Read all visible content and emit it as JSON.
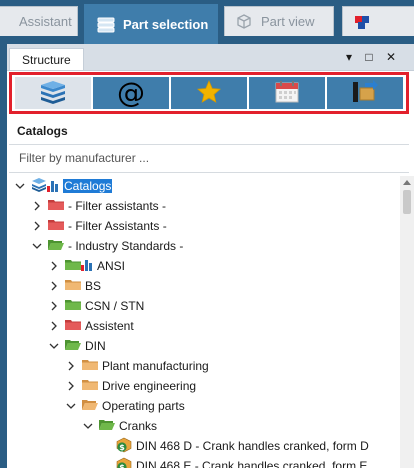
{
  "tabs": [
    {
      "label": "Assistant",
      "active": false
    },
    {
      "label": "Part selection",
      "active": true
    },
    {
      "label": "Part view",
      "active": false
    }
  ],
  "panel": {
    "tab_label": "Structure",
    "window_buttons": [
      "▾",
      "□",
      "✕"
    ],
    "toolbar_icons": [
      "catalog-stack-icon",
      "at-sign-icon",
      "star-icon",
      "calendar-icon",
      "export-icon"
    ],
    "toolbar_at_glyph": "@",
    "section_title": "Catalogs",
    "filter_placeholder": "Filter by manufacturer ..."
  },
  "tree": [
    {
      "label": "Catalogs",
      "level": 0,
      "expanded": true,
      "icon": "catalog-root-icon",
      "selected": true
    },
    {
      "label": "- Filter assistants -",
      "level": 1,
      "expanded": false,
      "icon": "red-folder-icon"
    },
    {
      "label": "- Filter Assistants -",
      "level": 1,
      "expanded": false,
      "icon": "red-folder-icon"
    },
    {
      "label": "- Industry Standards -",
      "level": 1,
      "expanded": true,
      "icon": "green-folder-open-icon"
    },
    {
      "label": "ANSI",
      "level": 2,
      "expanded": false,
      "icon": "green-folder-chart-icon"
    },
    {
      "label": "BS",
      "level": 2,
      "expanded": false,
      "icon": "orange-folder-icon"
    },
    {
      "label": "CSN / STN",
      "level": 2,
      "expanded": false,
      "icon": "green-folder-icon"
    },
    {
      "label": "Assistent",
      "level": 2,
      "expanded": false,
      "icon": "red-folder-icon"
    },
    {
      "label": "DIN",
      "level": 2,
      "expanded": true,
      "icon": "green-folder-open-icon"
    },
    {
      "label": "Plant manufacturing",
      "level": 3,
      "expanded": false,
      "icon": "orange-folder-icon"
    },
    {
      "label": "Drive engineering",
      "level": 3,
      "expanded": false,
      "icon": "orange-folder-icon"
    },
    {
      "label": "Operating parts",
      "level": 3,
      "expanded": true,
      "icon": "orange-folder-open-icon"
    },
    {
      "label": "Cranks",
      "level": 4,
      "expanded": true,
      "icon": "green-folder-open-icon"
    },
    {
      "label": "DIN 468 D - Crank handles cranked, form D",
      "level": 5,
      "expanded": null,
      "icon": "part-icon"
    },
    {
      "label": "DIN 468 E - Crank handles cranked, form E",
      "level": 5,
      "expanded": null,
      "icon": "part-icon"
    }
  ],
  "colors": {
    "accent": "#3f7dab",
    "highlight_frame": "#e2202c",
    "selection": "#1f7bd6"
  }
}
